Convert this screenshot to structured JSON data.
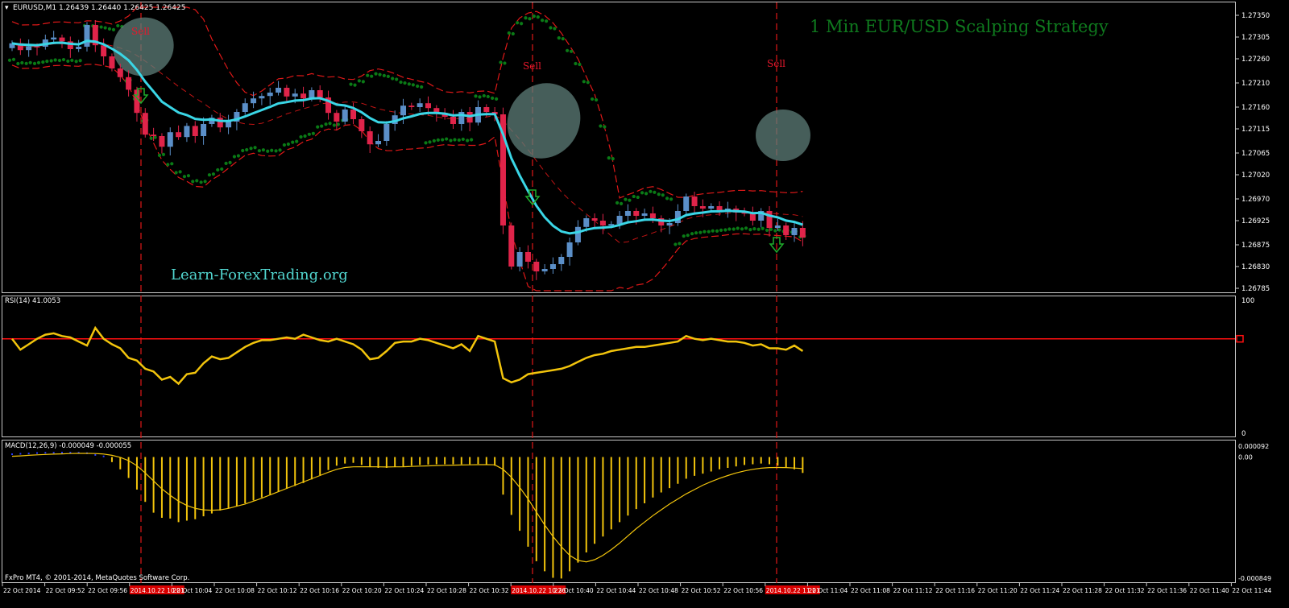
{
  "header": {
    "price_label": "EURUSD,M1  1.26439 1.26440 1.26425 1.26425",
    "rsi_label": "RSI(14) 41.0053",
    "macd_label": "MACD(12,26,9) -0.000049 -0.000055",
    "copyright": "FxPro MT4, © 2001-2014, MetaQuotes Software Corp."
  },
  "overlay": {
    "strategy_title": "1 Min EUR/USD Scalping Strategy",
    "watermark": "Learn-ForexTrading.org"
  },
  "colors": {
    "background": "#000000",
    "bull_candle": "#5b8fc8",
    "bear_candle": "#e0244a",
    "ema": "#3ad6e6",
    "bands": "#e01818",
    "psar": "#0a7a16",
    "rsi_line": "#f2c40c",
    "rsi_level": "#ff1010",
    "macd_hist": "#f2c40c",
    "title_green": "#0f7a1e",
    "watermark": "#52d6d0",
    "grid": "#c8c8c8",
    "ellipse": "#5d7d78"
  },
  "chart_data": [
    {
      "type": "candlestick",
      "panel": "price",
      "symbol": "EURUSD",
      "timeframe": "M1",
      "ylim": [
        1.26785,
        1.2735
      ],
      "y_ticks": [
        "1.27350",
        "1.27305",
        "1.27260",
        "1.27210",
        "1.27160",
        "1.27115",
        "1.27065",
        "1.27020",
        "1.26970",
        "1.26925",
        "1.26875",
        "1.26830",
        "1.26785"
      ],
      "x_ticks": [
        "22 Oct 2014",
        "22 Oct 09:52",
        "22 Oct 09:56",
        "2014.10.22 10:01",
        "22 Oct 10:04",
        "22 Oct 10:08",
        "22 Oct 10:12",
        "22 Oct 10:16",
        "22 Oct 10:20",
        "22 Oct 10:24",
        "22 Oct 10:28",
        "22 Oct 10:32",
        "2014.10.22 10:36",
        "22 Oct 10:40",
        "22 Oct 10:44",
        "22 Oct 10:48",
        "22 Oct 10:52",
        "22 Oct 10:56",
        "2014.10.22 11:01",
        "22 Oct 11:04",
        "22 Oct 11:08",
        "22 Oct 11:12",
        "22 Oct 11:16",
        "22 Oct 11:20",
        "22 Oct 11:24",
        "22 Oct 11:28",
        "22 Oct 11:32",
        "22 Oct 11:36",
        "22 Oct 11:40",
        "22 Oct 11:44"
      ],
      "highlighted_x_ticks": [
        3,
        12,
        18
      ],
      "closes": [
        1.27292,
        1.27278,
        1.27286,
        1.27285,
        1.273,
        1.27304,
        1.27296,
        1.2728,
        1.27285,
        1.2733,
        1.27288,
        1.27265,
        1.2724,
        1.27222,
        1.27196,
        1.27148,
        1.27103,
        1.271,
        1.27078,
        1.27108,
        1.27098,
        1.27121,
        1.271,
        1.27125,
        1.27138,
        1.27118,
        1.2713,
        1.2715,
        1.27168,
        1.27178,
        1.27183,
        1.2719,
        1.272,
        1.27182,
        1.27188,
        1.27178,
        1.27195,
        1.2718,
        1.27148,
        1.2713,
        1.27155,
        1.27135,
        1.2711,
        1.27083,
        1.2709,
        1.27125,
        1.27143,
        1.27163,
        1.2716,
        1.27168,
        1.27158,
        1.27148,
        1.2714,
        1.27125,
        1.2715,
        1.27128,
        1.2716,
        1.2715,
        1.27145,
        1.26915,
        1.2683,
        1.2686,
        1.2684,
        1.2682,
        1.26825,
        1.26835,
        1.2685,
        1.2688,
        1.26912,
        1.2693,
        1.26925,
        1.26915,
        1.26918,
        1.26935,
        1.26945,
        1.26935,
        1.2694,
        1.2693,
        1.26915,
        1.2692,
        1.26945,
        1.26975,
        1.26955,
        1.2695,
        1.26955,
        1.26945,
        1.2695,
        1.26942,
        1.2694,
        1.26925,
        1.26945,
        1.2691,
        1.26915,
        1.26895,
        1.2691,
        1.2689
      ],
      "indicators": [
        "EMA",
        "Bollinger Bands",
        "Parabolic SAR"
      ],
      "annotations": [
        {
          "text": "Sell",
          "bar": 10
        },
        {
          "text": "Sell",
          "bar": 39
        },
        {
          "text": "Sell",
          "bar": 58
        }
      ]
    },
    {
      "type": "line",
      "panel": "rsi",
      "name": "RSI(14)",
      "ylim": [
        0,
        100
      ],
      "y_ticks": [
        "100",
        "0"
      ],
      "level": 70,
      "values": [
        70,
        62,
        66,
        70,
        73,
        74,
        72,
        71,
        68,
        65,
        78,
        70,
        66,
        63,
        56,
        54,
        48,
        46,
        40,
        42,
        37,
        44,
        45,
        52,
        57,
        55,
        56,
        60,
        64,
        67,
        69,
        69,
        70,
        71,
        70,
        73,
        71,
        69,
        68,
        70,
        68,
        66,
        62,
        55,
        56,
        61,
        67,
        68,
        68,
        70,
        69,
        67,
        65,
        63,
        66,
        61,
        72,
        70,
        68,
        41,
        38,
        40,
        44,
        45,
        46,
        47,
        48,
        50,
        53,
        56,
        58,
        59,
        61,
        62,
        63,
        64,
        64,
        65,
        66,
        67,
        68,
        72,
        70,
        69,
        70,
        69,
        68,
        68,
        67,
        65,
        66,
        63,
        63,
        62,
        65,
        61
      ]
    },
    {
      "type": "bar",
      "panel": "macd",
      "name": "MACD(12,26,9)",
      "ylim": [
        -0.000849,
        9.2e-05
      ],
      "y_ticks": [
        "0.000092",
        "0.00",
        "-0.000849"
      ],
      "histogram": [
        2.5e-05,
        2.8e-05,
        3e-05,
        3.3e-05,
        3.5e-05,
        3.5e-05,
        3.6e-05,
        3.6e-05,
        3.5e-05,
        3.2e-05,
        2e-05,
        1e-05,
        -3.5e-05,
        -8.5e-05,
        -0.000145,
        -0.000225,
        -0.00031,
        -0.000385,
        -0.00042,
        -0.000425,
        -0.00045,
        -0.00044,
        -0.00043,
        -0.00041,
        -0.00039,
        -0.00037,
        -0.000355,
        -0.00034,
        -0.00032,
        -0.0003,
        -0.00028,
        -0.00026,
        -0.00024,
        -0.00022,
        -0.0002,
        -0.00018,
        -0.000155,
        -0.000125,
        -9e-05,
        -6e-05,
        -4.5e-05,
        -4e-05,
        -5.5e-05,
        -7e-05,
        -7.5e-05,
        -7.5e-05,
        -7e-05,
        -6.5e-05,
        -6e-05,
        -5.5e-05,
        -5.2e-05,
        -5e-05,
        -5e-05,
        -5e-05,
        -5e-05,
        -5e-05,
        -4.8e-05,
        -5.2e-05,
        -6e-05,
        -0.00026,
        -0.0004,
        -0.00051,
        -0.00062,
        -0.00072,
        -0.00079,
        -0.000835,
        -0.00084,
        -0.00079,
        -0.00073,
        -0.00066,
        -0.0006,
        -0.00055,
        -0.0005,
        -0.00045,
        -0.000405,
        -0.00036,
        -0.00032,
        -0.00028,
        -0.000245,
        -0.000215,
        -0.000185,
        -0.00015,
        -0.00013,
        -0.000115,
        -0.0001,
        -8.5e-05,
        -7.5e-05,
        -6.5e-05,
        -5.5e-05,
        -5e-05,
        -4.5e-05,
        -5e-05,
        -6e-05,
        -7.5e-05,
        -8.5e-05,
        -0.00011
      ],
      "signal": [
        5e-06,
        8e-06,
        1.2e-05,
        1.5e-05,
        1.8e-05,
        2e-05,
        2.2e-05,
        2.4e-05,
        2.5e-05,
        2.5e-05,
        2.4e-05,
        2.1e-05,
        1.2e-05,
        -2e-06,
        -2.5e-05,
        -6e-05,
        -0.00011,
        -0.000165,
        -0.00022,
        -0.000265,
        -0.000305,
        -0.000335,
        -0.000355,
        -0.000365,
        -0.000368,
        -0.000365,
        -0.000355,
        -0.00034,
        -0.000325,
        -0.000305,
        -0.000285,
        -0.000262,
        -0.00024,
        -0.000217,
        -0.000195,
        -0.000172,
        -0.00015,
        -0.000128,
        -0.000105,
        -8.5e-05,
        -7.2e-05,
        -6.8e-05,
        -6.7e-05,
        -6.7e-05,
        -6.8e-05,
        -6.9e-05,
        -6.8e-05,
        -6.7e-05,
        -6.5e-05,
        -6.3e-05,
        -6.1e-05,
        -5.9e-05,
        -5.7e-05,
        -5.6e-05,
        -5.5e-05,
        -5.4e-05,
        -5.3e-05,
        -5.3e-05,
        -5.4e-05,
        -8.5e-05,
        -0.00014,
        -0.00021,
        -0.00029,
        -0.00038,
        -0.00047,
        -0.00055,
        -0.00062,
        -0.00068,
        -0.000715,
        -0.000725,
        -0.00071,
        -0.00068,
        -0.00064,
        -0.000595,
        -0.000545,
        -0.000495,
        -0.00045,
        -0.000405,
        -0.000365,
        -0.000325,
        -0.00029,
        -0.000255,
        -0.000225,
        -0.000195,
        -0.00017,
        -0.000148,
        -0.000128,
        -0.00011,
        -9.6e-05,
        -8.5e-05,
        -7.7e-05,
        -7.3e-05,
        -7.2e-05,
        -7.3e-05,
        -7.6e-05,
        -8e-05
      ]
    }
  ]
}
